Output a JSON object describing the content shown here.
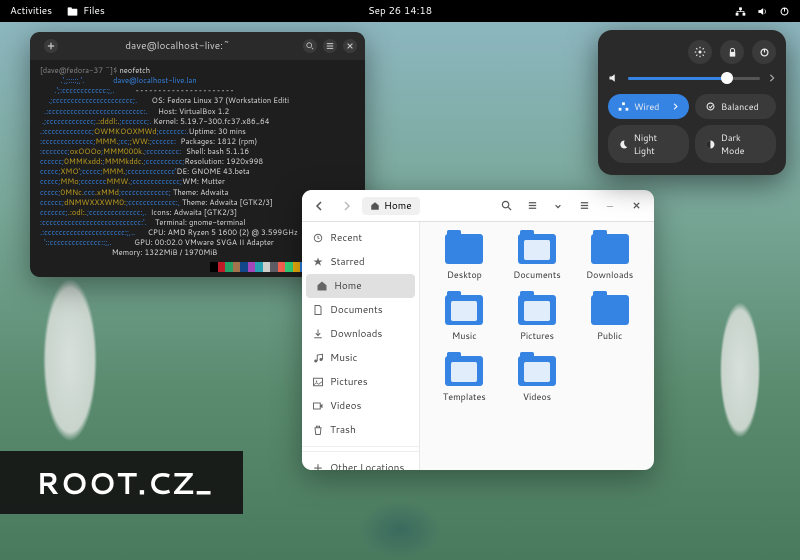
{
  "topbar": {
    "activities": "Activities",
    "app": "Files",
    "clock": "Sep 26  14:18"
  },
  "terminal": {
    "title": "dave@localhost-live:~",
    "prompt": "[dave@fedora-37 ~]$ ",
    "command": "neofetch",
    "info": {
      "user": "dave@localhost-live.lan",
      "os": "OS: Fedora Linux 37 (Workstation Editi",
      "host": "Host: VirtualBox 1.2",
      "kernel": "Kernel: 5.19.7-300.fc37.x86_64",
      "uptime": "Uptime: 30 mins",
      "packages": "Packages: 1812 (rpm)",
      "shell": "Shell: bash 5.1.16",
      "resolution": "Resolution: 1920x998",
      "de": "DE: GNOME 43.beta",
      "wm": "WM: Mutter",
      "theme": "Theme: Adwaita",
      "theme2": "Theme: Adwaita [GTK2/3]",
      "icons": "Icons: Adwaita [GTK2/3]",
      "terminal": "Terminal: gnome-terminal",
      "cpu": "CPU: AMD Ryzen 5 1600 (2) @ 3.599GHz",
      "gpu": "GPU: 00:02.0 VMware SVGA II Adapter",
      "memory": "Memory: 1322MiB / 1970MiB"
    },
    "swatches": [
      "#000",
      "#c01c28",
      "#26a269",
      "#a2734c",
      "#12488b",
      "#a347ba",
      "#2aa1b3",
      "#d0cfcc",
      "#5e5c64",
      "#f66151",
      "#33d17a",
      "#e9ad0c",
      "#2a7bde",
      "#c061cb",
      "#33c7de",
      "#ffffff"
    ]
  },
  "files": {
    "path_icon": "home",
    "path_label": "Home",
    "sidebar": [
      {
        "icon": "recent",
        "label": "Recent"
      },
      {
        "icon": "star",
        "label": "Starred"
      },
      {
        "icon": "home",
        "label": "Home",
        "active": true
      },
      {
        "icon": "doc",
        "label": "Documents"
      },
      {
        "icon": "down",
        "label": "Downloads"
      },
      {
        "icon": "music",
        "label": "Music"
      },
      {
        "icon": "pic",
        "label": "Pictures"
      },
      {
        "icon": "vid",
        "label": "Videos"
      },
      {
        "icon": "trash",
        "label": "Trash"
      },
      {
        "icon": "plus",
        "label": "Other Locations"
      }
    ],
    "folders": [
      "Desktop",
      "Documents",
      "Downloads",
      "Music",
      "Pictures",
      "Public",
      "Templates",
      "Videos"
    ]
  },
  "qs": {
    "wired": "Wired",
    "balanced": "Balanced",
    "night": "Night Light",
    "dark": "Dark Mode"
  },
  "watermark": "ROOT.CZ_"
}
